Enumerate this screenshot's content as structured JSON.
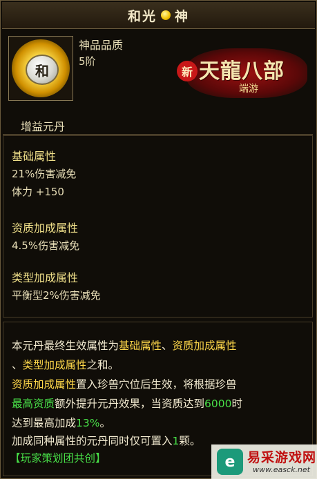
{
  "title": {
    "left": "和光",
    "right": "神"
  },
  "item": {
    "icon_char": "和",
    "quality": "神品品质",
    "stage": "5阶",
    "type": "增益元丹"
  },
  "logo": {
    "new": "新",
    "main": "天龍八部",
    "sub": "端游"
  },
  "stats": {
    "base_header": "基础属性",
    "base_lines": [
      "21%伤害减免",
      "体力 +150"
    ],
    "aptitude_header": "资质加成属性",
    "aptitude_lines": [
      "4.5%伤害减免"
    ],
    "type_header": "类型加成属性",
    "type_lines": [
      "平衡型2%伤害减免"
    ]
  },
  "description": {
    "l1_a": "本元丹最终生效属性为",
    "l1_b": "基础属性",
    "l1_c": "、",
    "l1_d": "资质加成属性",
    "l2_a": "、",
    "l2_b": "类型加成属性",
    "l2_c": "之和。",
    "l3_a": "资质加成属性",
    "l3_b": "置入珍兽穴位后生效，将根据珍兽",
    "l4_a": "最高资质",
    "l4_b": "额外提升元丹效果，当资质达到",
    "l4_c": "6000",
    "l4_d": "时",
    "l5_a": "达到最高加成",
    "l5_b": "13%",
    "l5_c": "。",
    "l6_a": "加成同种属性的元丹同时仅可置入",
    "l6_b": "1",
    "l6_c": "颗。",
    "footer": "【玩家策划团共创】"
  },
  "watermark": {
    "icon": "e",
    "name": "易采游戏网",
    "url": "www.easck.net"
  },
  "colors": {
    "highlight_yellow": "#ffd84a",
    "highlight_green": "#48e048",
    "header_gold": "#f0e08a"
  }
}
